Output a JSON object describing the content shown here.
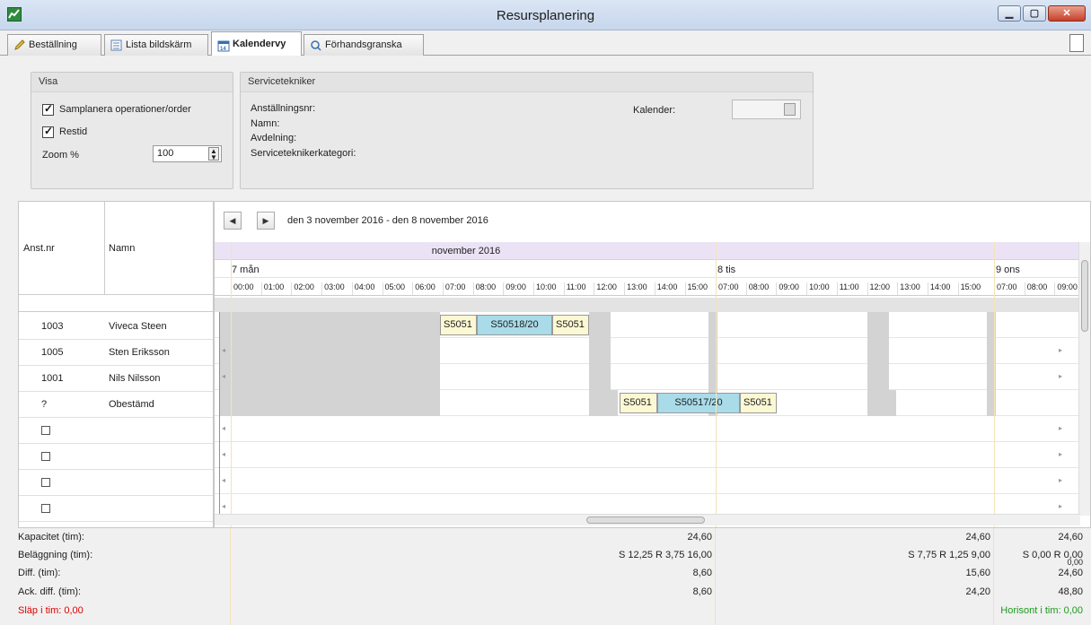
{
  "window": {
    "title": "Resursplanering"
  },
  "tabs": [
    {
      "label": "Beställning"
    },
    {
      "label": "Lista bildskärm"
    },
    {
      "label": "Kalendervy"
    },
    {
      "label": "Förhandsgranska"
    }
  ],
  "visa": {
    "title": "Visa",
    "chk1_label": "Samplanera operationer/order",
    "chk2_label": "Restid",
    "zoom_label": "Zoom %",
    "zoom_value": "100"
  },
  "servicetekniker": {
    "title": "Servicetekniker",
    "anst_label": "Anställningsnr:",
    "namn_label": "Namn:",
    "avd_label": "Avdelning:",
    "kat_label": "Serviceteknikerkategori:",
    "kalender_label": "Kalender:"
  },
  "resources": {
    "col_anst": "Anst.nr",
    "col_namn": "Namn",
    "rows": [
      {
        "nr": "1003",
        "namn": "Viveca Steen"
      },
      {
        "nr": "1005",
        "namn": "Sten Eriksson"
      },
      {
        "nr": "1001",
        "namn": "Nils Nilsson"
      },
      {
        "nr": "?",
        "namn": "Obestämd"
      }
    ]
  },
  "calendar": {
    "range": "den 3 november 2016 - den 8 november 2016",
    "month": "november 2016",
    "days": [
      "7 mån",
      "8 tis",
      "9 ons"
    ],
    "hours_day1": [
      "00:00",
      "01:00",
      "02:00",
      "03:00",
      "04:00",
      "05:00",
      "06:00",
      "07:00",
      "08:00",
      "09:00",
      "10:00",
      "11:00",
      "12:00",
      "13:00",
      "14:00",
      "15:00"
    ],
    "hours_day2": [
      "07:00",
      "08:00",
      "09:00",
      "10:00",
      "11:00",
      "12:00",
      "13:00",
      "14:00",
      "15:00"
    ],
    "hours_day3": [
      "07:00",
      "08:00",
      "09:00"
    ],
    "jobs": {
      "r1a": "S5051",
      "r1b": "S50518/20",
      "r1c": "S5051",
      "r4a": "S5051",
      "r4b": "S50517/20",
      "r4c": "S5051"
    }
  },
  "summary": {
    "kap_label": "Kapacitet (tim):",
    "bel_label": "Beläggning (tim):",
    "diff_label": "Diff. (tim):",
    "ack_label": "Ack. diff. (tim):",
    "slap_label": "Släp i tim: 0,00",
    "horisont_label": "Horisont i tim: 0,00",
    "day1": {
      "kap": "24,60",
      "bel": "S 12,25  R 3,75  16,00",
      "diff": "8,60",
      "ack": "8,60"
    },
    "day2": {
      "kap": "24,60",
      "bel": "S 7,75  R 1,25  9,00",
      "diff": "15,60",
      "ack": "24,20"
    },
    "day3": {
      "kap": "24,60",
      "bel": "S 0,00  R 0,00",
      "bel2": "0,00",
      "diff": "24,60",
      "ack": "48,80"
    }
  },
  "colors": {
    "free_slot": "#ffffff",
    "blocked": "#d3d3d3",
    "job_yellow": "#fbf8d3",
    "job_blue": "#a9dbe8",
    "month_band": "#ebe3f5",
    "slap_red": "#e00000",
    "horisont_green": "#1a9a1a"
  }
}
